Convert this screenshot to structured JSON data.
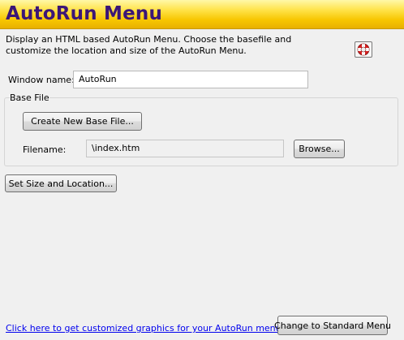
{
  "header": {
    "title": "AutoRun Menu"
  },
  "description": "Display an HTML based AutoRun Menu. Choose the basefile and customize the location and size of the AutoRun Menu.",
  "window_name": {
    "label": "Window name:",
    "value": "AutoRun"
  },
  "base_file": {
    "group_title": "Base File",
    "create_button": "Create New Base File...",
    "filename_label": "Filename:",
    "filename_value": "\\index.htm",
    "browse_button": "Browse..."
  },
  "set_size_button": "Set Size and Location...",
  "footer": {
    "link_text": "Click here to get customized graphics for your AutoRun menu.",
    "change_button": "Change to Standard Menu"
  },
  "colors": {
    "title": "#3b1677",
    "header_gradient": "#f7c600",
    "link": "#0000ee",
    "help_icon": "#d61f1f"
  },
  "icons": {
    "help": "lifebuoy-icon"
  }
}
